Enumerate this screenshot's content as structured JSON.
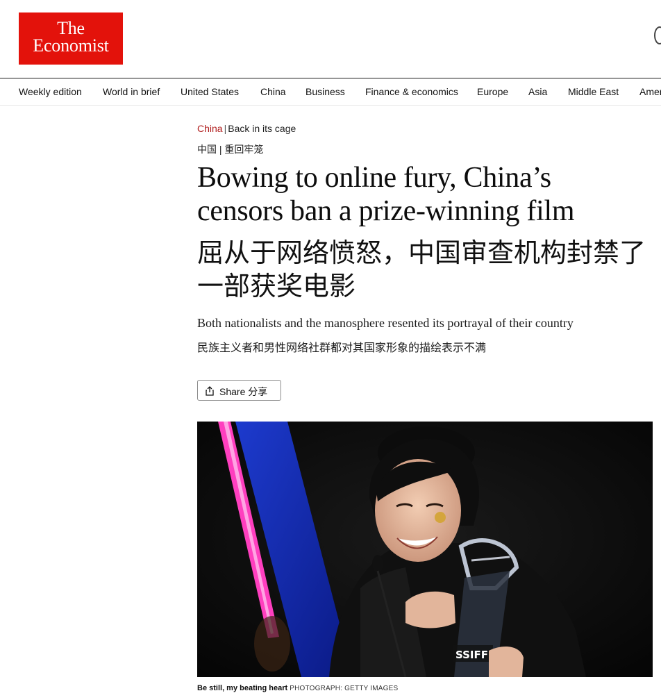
{
  "brand": {
    "line1": "The",
    "line2": "Economist",
    "color": "#e3120b"
  },
  "nav": {
    "items": [
      "Weekly edition",
      "World in brief",
      "United States",
      "China",
      "Business",
      "Finance & economics",
      "Europe",
      "Asia",
      "Middle East",
      "Amer"
    ]
  },
  "article": {
    "section": "China",
    "fly_title": "Back in its cage",
    "kicker_cn": "中国 | 重回牢笼",
    "headline": "Bowing to online fury, China’s censors ban a prize-winning film",
    "headline_cn": "屈从于网络愤怒，中国审查机构封禁了一部获奖电影",
    "rubric": "Both nationalists and the manosphere resented its portrayal of their country",
    "rubric_cn": "民族主义者和男性网络社群都对其国家形象的描绘表示不满",
    "share_label": "Share 分享",
    "image": {
      "trophy_text": "SSIFF"
    },
    "caption": "Be still, my beating heart",
    "credit": "PHOTOGRAPH: GETTY IMAGES"
  },
  "colors": {
    "section_red": "#b01c1c",
    "text": "#0d0d0d"
  }
}
